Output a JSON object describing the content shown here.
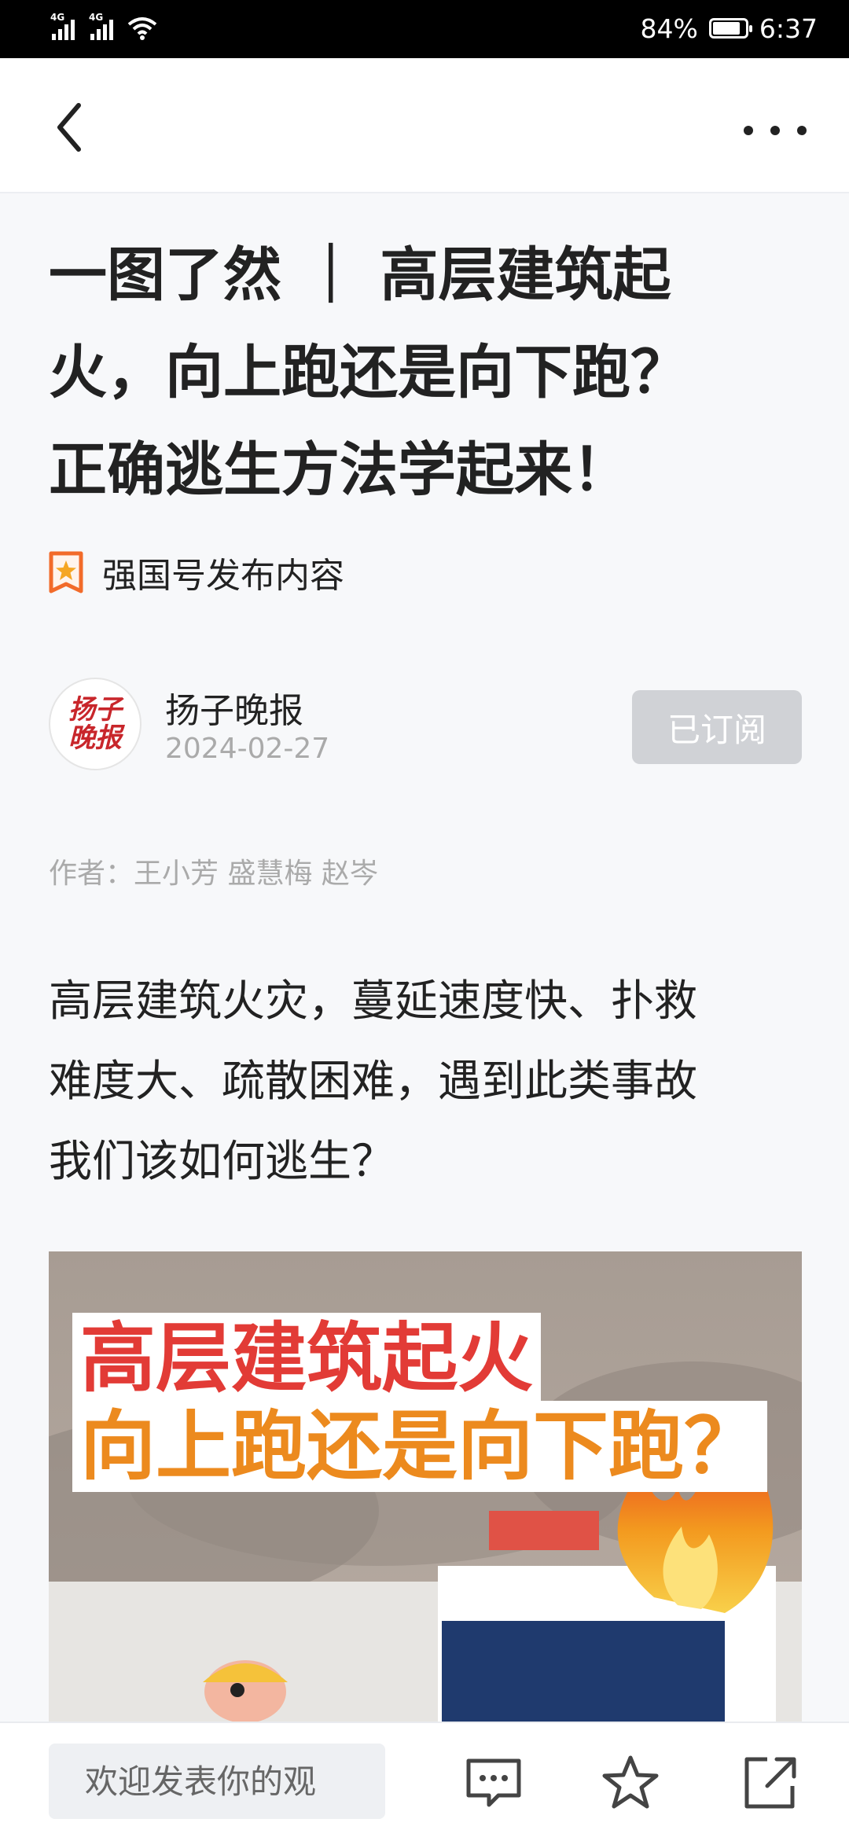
{
  "status_bar": {
    "network_1": "4G",
    "network_2": "4G",
    "battery_percent": "84%",
    "battery_level": 0.84,
    "time": "6:37"
  },
  "nav": {
    "back_icon": "chevron-left-icon",
    "more_icon": "more-horizontal-icon"
  },
  "article": {
    "title_lines": [
      "一图了然 ｜ 高层建筑起",
      "火，向上跑还是向下跑？",
      "正确逃生方法学起来！"
    ],
    "source_tag": "强国号发布内容",
    "author": {
      "avatar_text": [
        "扬子",
        "晚报"
      ],
      "name": "扬子晚报",
      "date": "2024-02-27",
      "subscribe_label": "已订阅"
    },
    "byline": "作者：王小芳 盛慧梅 赵岑",
    "paragraph_lines": [
      "高层建筑火灾，蔓延速度快、扑救",
      "难度大、疏散困难，遇到此类事故",
      "我们该如何逃生？"
    ],
    "image": {
      "headline_line_1": "高层建筑起火",
      "headline_line_2": "向上跑还是向下跑？"
    }
  },
  "bottom_bar": {
    "comment_placeholder": "欢迎发表你的观",
    "icons": [
      "comment-icon",
      "star-icon",
      "share-icon"
    ]
  },
  "colors": {
    "accent_red": "#e23b36",
    "accent_orange": "#ec8a1e",
    "badge_orange": "#f26b2a",
    "subscribe_bg": "#d0d2d6"
  }
}
